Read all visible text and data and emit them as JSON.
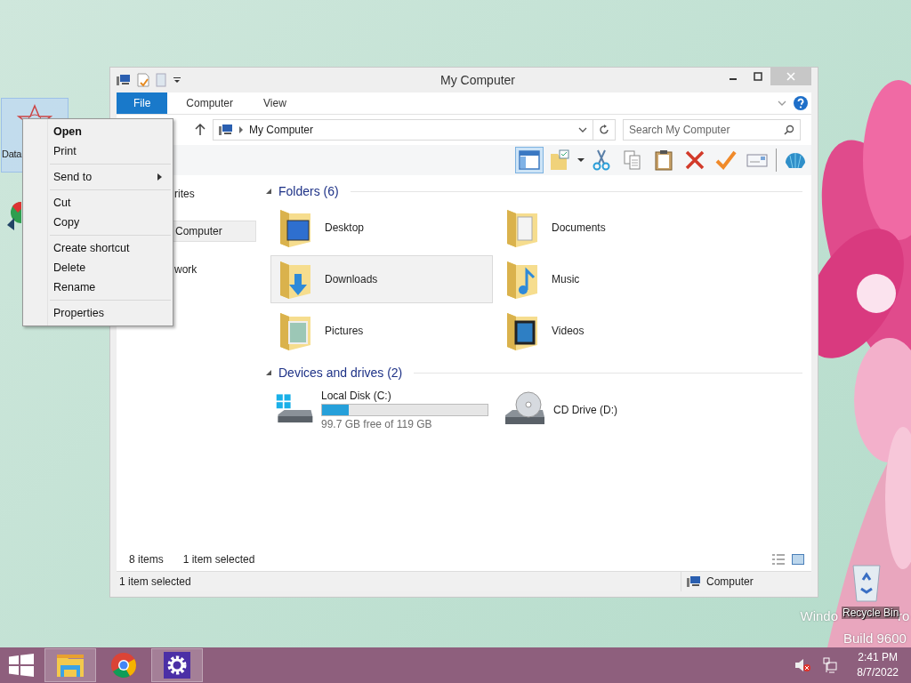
{
  "desktop": {
    "icons": [
      {
        "kind": "app",
        "label": "Data",
        "selected": true
      },
      {
        "kind": "browser",
        "selected": false
      }
    ],
    "recycle_bin": {
      "label": "Recycle Bin"
    },
    "watermark": {
      "line_1_parts": [
        "Windo",
        "ro"
      ],
      "line_2": "Build 9600"
    }
  },
  "window": {
    "title": "My Computer",
    "ribbon_tabs": [
      {
        "label": "File",
        "selected": true
      },
      {
        "label": "Computer",
        "selected": false
      },
      {
        "label": "View",
        "selected": false
      }
    ],
    "address": {
      "path": "My Computer"
    },
    "search": {
      "placeholder": "Search My Computer"
    },
    "layout_pane": {
      "on": true
    },
    "toolbar": [
      {
        "kind": "properties"
      },
      {
        "kind": "cut"
      },
      {
        "kind": "copy"
      },
      {
        "kind": "paste"
      },
      {
        "kind": "delete"
      },
      {
        "kind": "check"
      },
      {
        "kind": "rename"
      },
      {
        "kind": "shell"
      }
    ],
    "navigation": [
      {
        "label": "rites",
        "selected": false
      },
      {
        "label": "Computer",
        "selected": true
      },
      {
        "label": "work",
        "selected": false
      }
    ],
    "groups": [
      {
        "title": "Folders (6)",
        "expanded": true,
        "items": [
          {
            "kind": "desktop",
            "label": "Desktop",
            "selected": false
          },
          {
            "kind": "documents",
            "label": "Documents",
            "selected": false
          },
          {
            "kind": "downloads",
            "label": "Downloads",
            "selected": true
          },
          {
            "kind": "music",
            "label": "Music",
            "selected": false
          },
          {
            "kind": "pictures",
            "label": "Pictures",
            "selected": false
          },
          {
            "kind": "videos",
            "label": "Videos",
            "selected": false
          }
        ]
      },
      {
        "title": "Devices and drives (2)",
        "expanded": true,
        "items": [
          {
            "kind": "disk",
            "label": "Local Disk (C:)",
            "level": 0.16,
            "detail": "99.7 GB free of 119 GB",
            "selected": false
          },
          {
            "kind": "optical",
            "label": "CD Drive (D:)",
            "selected": false
          }
        ]
      }
    ],
    "footer": {
      "item_count": "8 items",
      "selection": "1 item selected"
    },
    "status_bar": {
      "text": "1 item selected",
      "location": "Computer"
    }
  },
  "context_menu": {
    "sections": [
      [
        {
          "label": "Open",
          "default": true,
          "submenu": false
        },
        {
          "label": "Print",
          "default": false,
          "submenu": false
        }
      ],
      [
        {
          "label": "Send to",
          "default": false,
          "submenu": true
        }
      ],
      [
        {
          "label": "Cut",
          "default": false,
          "submenu": false
        },
        {
          "label": "Copy",
          "default": false,
          "submenu": false
        }
      ],
      [
        {
          "label": "Create shortcut",
          "default": false,
          "submenu": false
        },
        {
          "label": "Delete",
          "default": false,
          "submenu": false
        },
        {
          "label": "Rename",
          "default": false,
          "submenu": false
        }
      ],
      [
        {
          "label": "Properties",
          "default": false,
          "submenu": false
        }
      ]
    ]
  },
  "taskbar": {
    "apps": [
      {
        "kind": "explorer",
        "running": true
      },
      {
        "kind": "chrome",
        "running": false
      },
      {
        "kind": "settings",
        "running": true
      }
    ],
    "tray": {
      "muted": true
    },
    "clock": {
      "time": "2:41 PM",
      "date": "8/7/2022"
    }
  }
}
